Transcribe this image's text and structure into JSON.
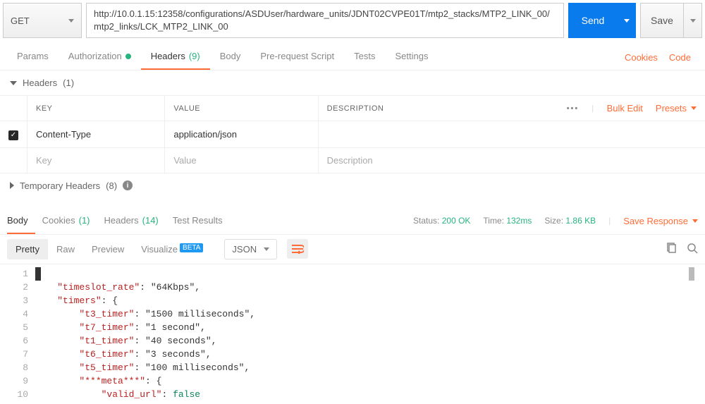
{
  "method": "GET",
  "url": "http://10.0.1.15:12358/configurations/ASDUser/hardware_units/JDNT02CVPE01T/mtp2_stacks/MTP2_LINK_00/mtp2_links/LCK_MTP2_LINK_00",
  "buttons": {
    "send": "Send",
    "save": "Save"
  },
  "req_tabs": {
    "params": "Params",
    "auth": "Authorization",
    "headers": "Headers",
    "headers_count": "(9)",
    "body": "Body",
    "prerequest": "Pre-request Script",
    "tests": "Tests",
    "settings": "Settings"
  },
  "top_links": {
    "cookies": "Cookies",
    "code": "Code"
  },
  "headers_section": {
    "title": "Headers",
    "count": "(1)"
  },
  "hdr_table": {
    "cols": {
      "key": "KEY",
      "value": "VALUE",
      "desc": "DESCRIPTION"
    },
    "row1": {
      "key": "Content-Type",
      "value": "application/json",
      "desc": ""
    },
    "ph": {
      "key": "Key",
      "value": "Value",
      "desc": "Description"
    },
    "actions": {
      "bulk": "Bulk Edit",
      "presets": "Presets"
    }
  },
  "temp_headers": {
    "title": "Temporary Headers",
    "count": "(8)"
  },
  "resp_tabs": {
    "body": "Body",
    "cookies": "Cookies",
    "cookies_count": "(1)",
    "headers": "Headers",
    "headers_count": "(14)",
    "tests": "Test Results"
  },
  "resp_meta": {
    "status_l": "Status:",
    "status_v": "200 OK",
    "time_l": "Time:",
    "time_v": "132ms",
    "size_l": "Size:",
    "size_v": "1.86 KB",
    "save": "Save Response"
  },
  "body_modes": {
    "pretty": "Pretty",
    "raw": "Raw",
    "preview": "Preview",
    "visualize": "Visualize",
    "beta": "BETA"
  },
  "lang": "JSON",
  "code_lines": [
    "{",
    "    \"timeslot_rate\": \"64Kbps\",",
    "    \"timers\": {",
    "        \"t3_timer\": \"1500 milliseconds\",",
    "        \"t7_timer\": \"1 second\",",
    "        \"t1_timer\": \"40 seconds\",",
    "        \"t6_timer\": \"3 seconds\",",
    "        \"t5_timer\": \"100 milliseconds\",",
    "        \"***meta***\": {",
    "            \"valid_url\": false"
  ]
}
